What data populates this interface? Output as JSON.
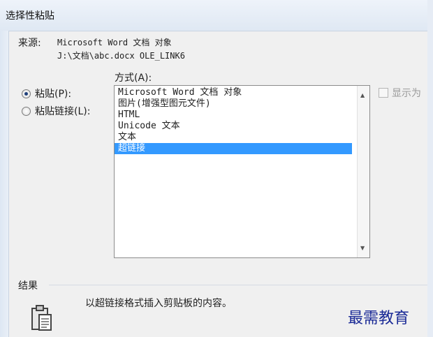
{
  "window": {
    "title": "选择性粘贴"
  },
  "source": {
    "label": "来源:",
    "line1": "Microsoft Word 文档 对象",
    "line2": "J:\\文档\\abc.docx OLE_LINK6"
  },
  "method": {
    "label": "方式(A):",
    "options": [
      {
        "label": "Microsoft Word 文档 对象",
        "selected": false
      },
      {
        "label": "图片(增强型图元文件)",
        "selected": false
      },
      {
        "label": "HTML",
        "selected": false
      },
      {
        "label": "Unicode 文本",
        "selected": false
      },
      {
        "label": "文本",
        "selected": false
      },
      {
        "label": "超链接",
        "selected": true
      }
    ]
  },
  "paste": {
    "paste_label": "粘贴(P):",
    "paste_link_label": "粘贴链接(L):",
    "selected": "paste"
  },
  "display_as_icon": {
    "label": "显示为",
    "checked": false
  },
  "result": {
    "label": "结果",
    "text": "以超链接格式插入剪贴板的内容。"
  },
  "watermark": "最需教育",
  "colors": {
    "selection": "#3399ff",
    "watermark": "#1a2a96"
  }
}
